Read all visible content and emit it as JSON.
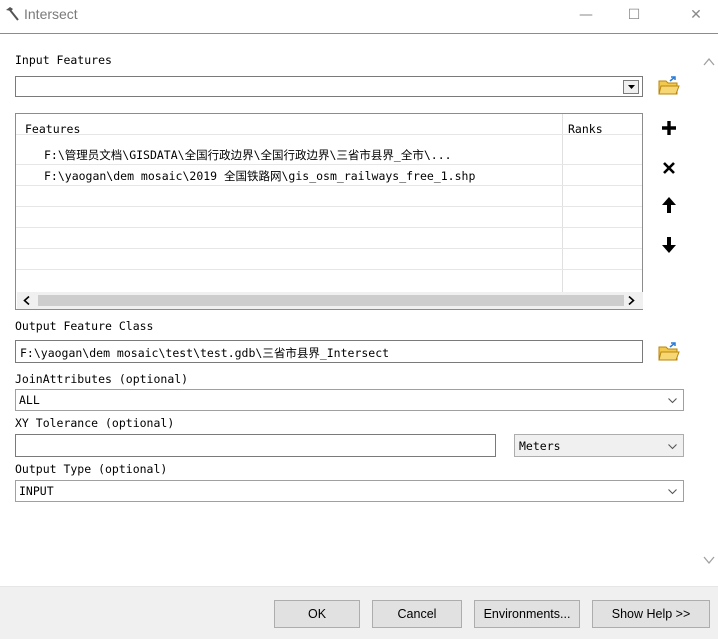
{
  "window": {
    "title": "Intersect",
    "minimize_glyph": "—",
    "maximize_glyph": "☐",
    "close_glyph": "✕"
  },
  "input_features": {
    "label": "Input Features",
    "value": ""
  },
  "features_table": {
    "col_features": "Features",
    "col_ranks": "Ranks",
    "rows": [
      {
        "feature": "F:\\管理员文档\\GISDATA\\全国行政边界\\全国行政边界\\三省市县界_全市\\...",
        "rank": ""
      },
      {
        "feature": "F:\\yaogan\\dem mosaic\\2019 全国铁路网\\gis_osm_railways_free_1.shp",
        "rank": ""
      }
    ]
  },
  "side_buttons": {
    "add": "+",
    "remove": "×",
    "up": "↑",
    "down": "↓"
  },
  "output_feature_class": {
    "label": "Output Feature Class",
    "value": "F:\\yaogan\\dem mosaic\\test\\test.gdb\\三省市县界_Intersect"
  },
  "join_attributes": {
    "label": "JoinAttributes (optional)",
    "value": "ALL"
  },
  "xy_tolerance": {
    "label": "XY Tolerance (optional)",
    "value": "",
    "unit": "Meters"
  },
  "output_type": {
    "label": "Output Type (optional)",
    "value": "INPUT"
  },
  "footer": {
    "ok": "OK",
    "cancel": "Cancel",
    "environments": "Environments...",
    "show_help": "Show Help >>"
  },
  "colors": {
    "accent_folder": "#e8a92a",
    "scroll_thumb": "#cdcdcd"
  }
}
